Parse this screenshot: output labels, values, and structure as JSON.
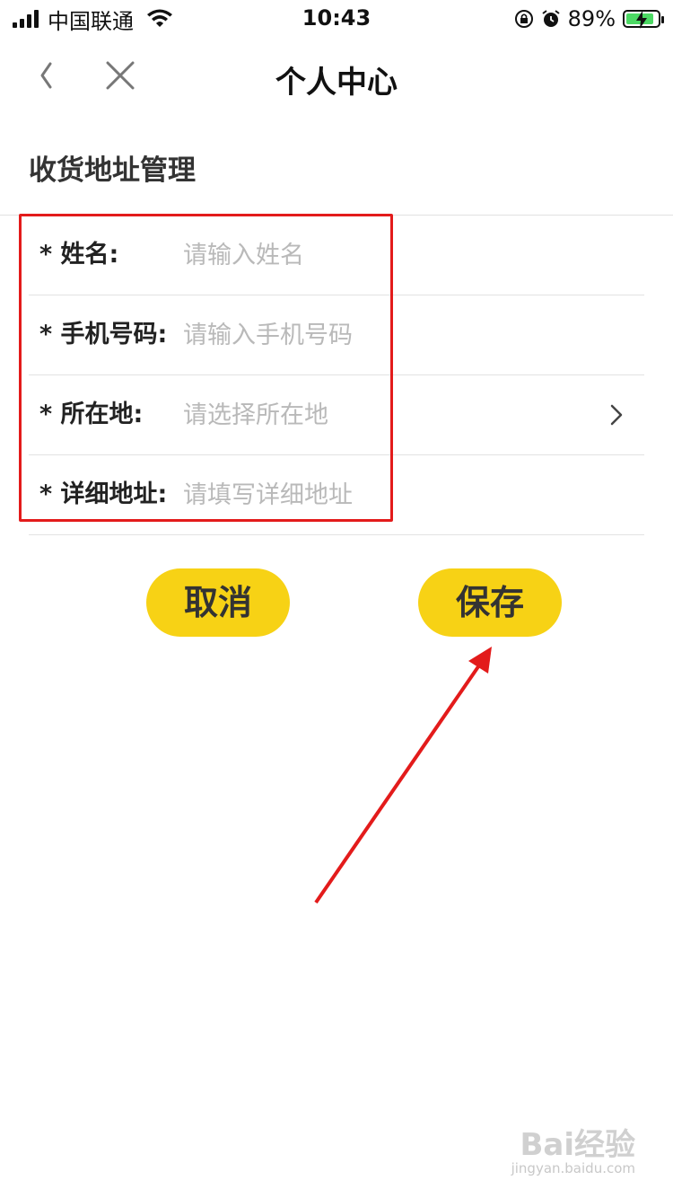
{
  "status_bar": {
    "carrier": "中国联通",
    "time": "10:43",
    "battery": "89%"
  },
  "nav": {
    "title": "个人中心"
  },
  "section": {
    "title": "收货地址管理"
  },
  "form": {
    "fields": [
      {
        "label": "* 姓名:",
        "placeholder": "请输入姓名"
      },
      {
        "label": "* 手机号码:",
        "placeholder": "请输入手机号码"
      },
      {
        "label": "* 所在地:",
        "placeholder": "请选择所在地"
      },
      {
        "label": "* 详细地址:",
        "placeholder": "请填写详细地址"
      }
    ]
  },
  "buttons": {
    "cancel": "取消",
    "save": "保存"
  },
  "watermark": {
    "logo_text": "Bai经验",
    "url": "jingyan.baidu.com"
  },
  "colors": {
    "accent_yellow": "#f7d215",
    "highlight_red": "#e31b1b",
    "placeholder_gray": "#b9b9b9"
  }
}
